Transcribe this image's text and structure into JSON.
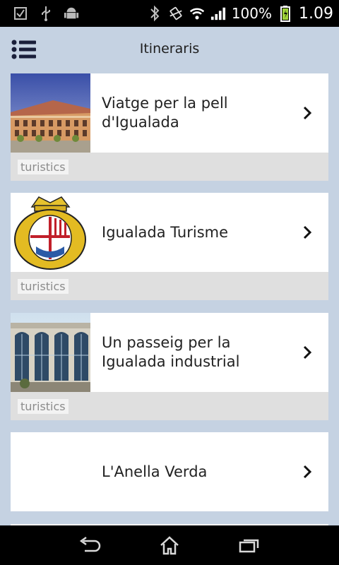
{
  "status_bar": {
    "battery_text": "100%",
    "time": "1.09",
    "icons": [
      "checkbox-icon",
      "usb-icon",
      "android-icon",
      "bluetooth-icon",
      "vibrate-icon",
      "wifi-icon",
      "signal-icon",
      "battery-icon"
    ]
  },
  "header": {
    "title": "Itineraris",
    "menu_icon": "list-menu-icon"
  },
  "items": [
    {
      "title_line1": "Viatge per la pell",
      "title_line2": "d'Igualada",
      "tag": "turistics",
      "thumb": "building-photo"
    },
    {
      "title_line1": "Igualada Turisme",
      "title_line2": "",
      "tag": "turistics",
      "thumb": "coat-of-arms"
    },
    {
      "title_line1": "Un passeig per la",
      "title_line2": "Igualada industrial",
      "tag": "turistics",
      "thumb": "industrial-building-photo"
    },
    {
      "title_line1": "L'Anella Verda",
      "title_line2": "",
      "tag": "",
      "thumb": ""
    }
  ],
  "nav_bar": {
    "buttons": [
      "back-icon",
      "home-icon",
      "recents-icon"
    ]
  },
  "colors": {
    "background": "#c5d2e2",
    "card": "#ffffff",
    "tag_row": "#dfdfdf",
    "status_bar": "#000000"
  }
}
